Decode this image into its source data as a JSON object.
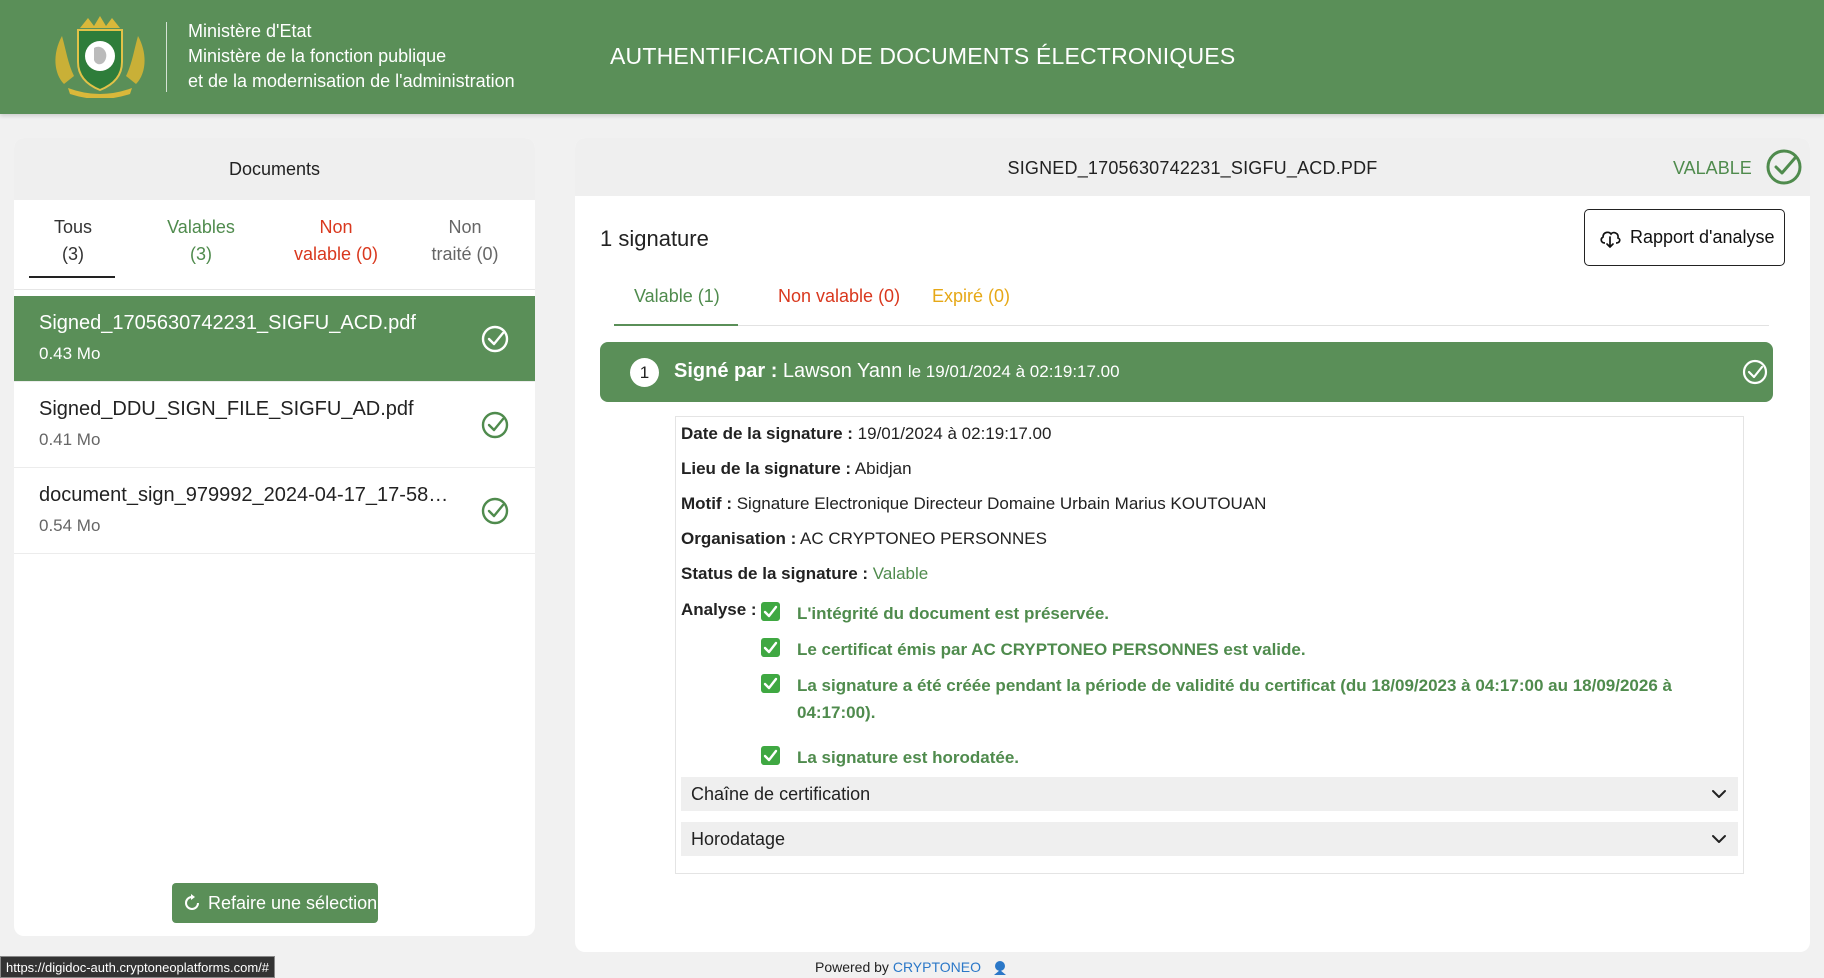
{
  "header": {
    "ministry_line1": "Ministère d'Etat",
    "ministry_line2": "Ministère de la fonction publique",
    "ministry_line3": "et de la modernisation de l'administration",
    "app_title": "AUTHENTIFICATION DE DOCUMENTS ÉLECTRONIQUES"
  },
  "left": {
    "title": "Documents",
    "tabs": [
      {
        "line1": "Tous",
        "line2": "(3)"
      },
      {
        "line1": "Valables",
        "line2": "(3)"
      },
      {
        "line1": "Non",
        "line2": "valable (0)"
      },
      {
        "line1": "Non",
        "line2": "traité (0)"
      }
    ],
    "documents": [
      {
        "name": "Signed_1705630742231_SIGFU_ACD.pdf",
        "size": "0.43 Mo",
        "icon": "check-circle-icon"
      },
      {
        "name": "Signed_DDU_SIGN_FILE_SIGFU_AD.pdf",
        "size": "0.41 Mo",
        "icon": "check-circle-icon"
      },
      {
        "name": "document_sign_979992_2024-04-17_17-58…",
        "size": "0.54 Mo",
        "icon": "check-circle-icon"
      }
    ],
    "reset_label": "Refaire une sélection"
  },
  "right": {
    "file_title": "SIGNED_1705630742231_SIGFU_ACD.PDF",
    "status": "VALABLE",
    "sig_count": "1 signature",
    "report_label": "Rapport d'analyse",
    "tabs": {
      "valid": "Valable (1)",
      "invalid": "Non valable (0)",
      "expired": "Expiré (0)"
    },
    "signature": {
      "number": "1",
      "signed_by_label": "Signé par :",
      "signer": "Lawson Yann",
      "date_suffix": "le 19/01/2024 à 02:19:17.00"
    },
    "details": {
      "date_label": "Date de la signature :",
      "date_value": "19/01/2024 à 02:19:17.00",
      "place_label": "Lieu de la signature :",
      "place_value": "Abidjan",
      "reason_label": "Motif :",
      "reason_value": "Signature Electronique Directeur Domaine Urbain Marius KOUTOUAN",
      "org_label": "Organisation :",
      "org_value": "AC CRYPTONEO PERSONNES",
      "status_label": "Status de la signature :",
      "status_value": "Valable",
      "analysis_label": "Analyse :",
      "analysis": [
        "L'intégrité du document est préservée.",
        "Le certificat émis par AC CRYPTONEO PERSONNES est valide.",
        "La signature a été créée pendant la période de validité du certificat (du 18/09/2023 à 04:17:00 au 18/09/2026 à 04:17:00).",
        "La signature est horodatée."
      ],
      "accordion1": "Chaîne de certification",
      "accordion2": "Horodatage"
    }
  },
  "footer": {
    "status_url": "https://digidoc-auth.cryptoneoplatforms.com/#",
    "powered_by": "Powered by",
    "brand": "CRYPTONEO"
  },
  "colors": {
    "primary_green": "#5a8f58",
    "valid_text": "#4f8b4d",
    "invalid_text": "#d9381e",
    "expired_text": "#e6a817",
    "brand_blue": "#2b78c8"
  }
}
